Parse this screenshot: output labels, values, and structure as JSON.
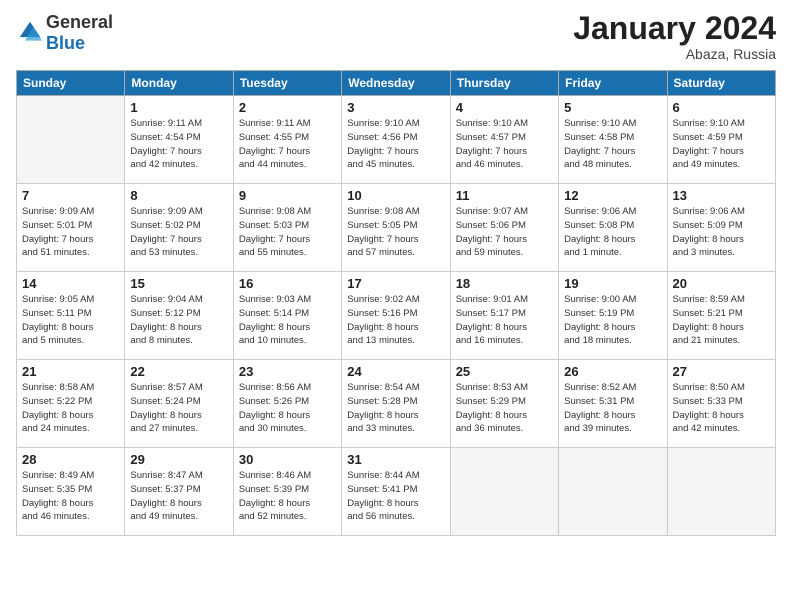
{
  "header": {
    "logo": {
      "general": "General",
      "blue": "Blue"
    },
    "title": "January 2024",
    "location": "Abaza, Russia"
  },
  "weekdays": [
    "Sunday",
    "Monday",
    "Tuesday",
    "Wednesday",
    "Thursday",
    "Friday",
    "Saturday"
  ],
  "weeks": [
    [
      {
        "day": "",
        "info": ""
      },
      {
        "day": "1",
        "info": "Sunrise: 9:11 AM\nSunset: 4:54 PM\nDaylight: 7 hours\nand 42 minutes."
      },
      {
        "day": "2",
        "info": "Sunrise: 9:11 AM\nSunset: 4:55 PM\nDaylight: 7 hours\nand 44 minutes."
      },
      {
        "day": "3",
        "info": "Sunrise: 9:10 AM\nSunset: 4:56 PM\nDaylight: 7 hours\nand 45 minutes."
      },
      {
        "day": "4",
        "info": "Sunrise: 9:10 AM\nSunset: 4:57 PM\nDaylight: 7 hours\nand 46 minutes."
      },
      {
        "day": "5",
        "info": "Sunrise: 9:10 AM\nSunset: 4:58 PM\nDaylight: 7 hours\nand 48 minutes."
      },
      {
        "day": "6",
        "info": "Sunrise: 9:10 AM\nSunset: 4:59 PM\nDaylight: 7 hours\nand 49 minutes."
      }
    ],
    [
      {
        "day": "7",
        "info": "Sunrise: 9:09 AM\nSunset: 5:01 PM\nDaylight: 7 hours\nand 51 minutes."
      },
      {
        "day": "8",
        "info": "Sunrise: 9:09 AM\nSunset: 5:02 PM\nDaylight: 7 hours\nand 53 minutes."
      },
      {
        "day": "9",
        "info": "Sunrise: 9:08 AM\nSunset: 5:03 PM\nDaylight: 7 hours\nand 55 minutes."
      },
      {
        "day": "10",
        "info": "Sunrise: 9:08 AM\nSunset: 5:05 PM\nDaylight: 7 hours\nand 57 minutes."
      },
      {
        "day": "11",
        "info": "Sunrise: 9:07 AM\nSunset: 5:06 PM\nDaylight: 7 hours\nand 59 minutes."
      },
      {
        "day": "12",
        "info": "Sunrise: 9:06 AM\nSunset: 5:08 PM\nDaylight: 8 hours\nand 1 minute."
      },
      {
        "day": "13",
        "info": "Sunrise: 9:06 AM\nSunset: 5:09 PM\nDaylight: 8 hours\nand 3 minutes."
      }
    ],
    [
      {
        "day": "14",
        "info": "Sunrise: 9:05 AM\nSunset: 5:11 PM\nDaylight: 8 hours\nand 5 minutes."
      },
      {
        "day": "15",
        "info": "Sunrise: 9:04 AM\nSunset: 5:12 PM\nDaylight: 8 hours\nand 8 minutes."
      },
      {
        "day": "16",
        "info": "Sunrise: 9:03 AM\nSunset: 5:14 PM\nDaylight: 8 hours\nand 10 minutes."
      },
      {
        "day": "17",
        "info": "Sunrise: 9:02 AM\nSunset: 5:16 PM\nDaylight: 8 hours\nand 13 minutes."
      },
      {
        "day": "18",
        "info": "Sunrise: 9:01 AM\nSunset: 5:17 PM\nDaylight: 8 hours\nand 16 minutes."
      },
      {
        "day": "19",
        "info": "Sunrise: 9:00 AM\nSunset: 5:19 PM\nDaylight: 8 hours\nand 18 minutes."
      },
      {
        "day": "20",
        "info": "Sunrise: 8:59 AM\nSunset: 5:21 PM\nDaylight: 8 hours\nand 21 minutes."
      }
    ],
    [
      {
        "day": "21",
        "info": "Sunrise: 8:58 AM\nSunset: 5:22 PM\nDaylight: 8 hours\nand 24 minutes."
      },
      {
        "day": "22",
        "info": "Sunrise: 8:57 AM\nSunset: 5:24 PM\nDaylight: 8 hours\nand 27 minutes."
      },
      {
        "day": "23",
        "info": "Sunrise: 8:56 AM\nSunset: 5:26 PM\nDaylight: 8 hours\nand 30 minutes."
      },
      {
        "day": "24",
        "info": "Sunrise: 8:54 AM\nSunset: 5:28 PM\nDaylight: 8 hours\nand 33 minutes."
      },
      {
        "day": "25",
        "info": "Sunrise: 8:53 AM\nSunset: 5:29 PM\nDaylight: 8 hours\nand 36 minutes."
      },
      {
        "day": "26",
        "info": "Sunrise: 8:52 AM\nSunset: 5:31 PM\nDaylight: 8 hours\nand 39 minutes."
      },
      {
        "day": "27",
        "info": "Sunrise: 8:50 AM\nSunset: 5:33 PM\nDaylight: 8 hours\nand 42 minutes."
      }
    ],
    [
      {
        "day": "28",
        "info": "Sunrise: 8:49 AM\nSunset: 5:35 PM\nDaylight: 8 hours\nand 46 minutes."
      },
      {
        "day": "29",
        "info": "Sunrise: 8:47 AM\nSunset: 5:37 PM\nDaylight: 8 hours\nand 49 minutes."
      },
      {
        "day": "30",
        "info": "Sunrise: 8:46 AM\nSunset: 5:39 PM\nDaylight: 8 hours\nand 52 minutes."
      },
      {
        "day": "31",
        "info": "Sunrise: 8:44 AM\nSunset: 5:41 PM\nDaylight: 8 hours\nand 56 minutes."
      },
      {
        "day": "",
        "info": ""
      },
      {
        "day": "",
        "info": ""
      },
      {
        "day": "",
        "info": ""
      }
    ]
  ]
}
